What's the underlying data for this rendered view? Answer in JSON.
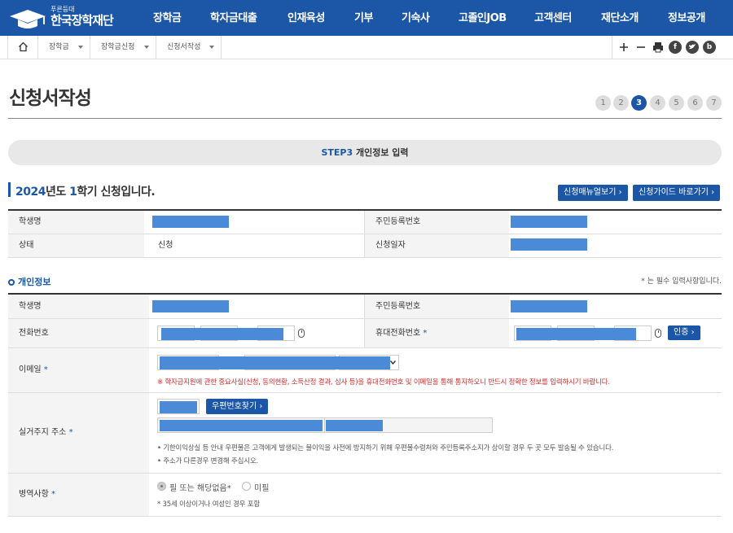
{
  "header": {
    "logo_sub": "푸른등대",
    "logo_name": "한국장학재단",
    "nav": [
      "장학금",
      "학자금대출",
      "인재육성",
      "기부",
      "기숙사",
      "고졸인JOB",
      "고객센터",
      "재단소개",
      "정보공개"
    ]
  },
  "breadcrumb": {
    "items": [
      "장학금",
      "장학금신청",
      "신청서작성"
    ],
    "tools": [
      "+",
      "−",
      "print-icon",
      "f",
      "twitter-icon",
      "b"
    ]
  },
  "page": {
    "title": "신청서작성",
    "steps": [
      "1",
      "2",
      "3",
      "4",
      "5",
      "6",
      "7"
    ],
    "active_step": "3",
    "banner_step": "STEP3",
    "banner_text": " 개인정보 입력"
  },
  "section": {
    "year": "2024",
    "mid1": "년도 ",
    "term": "1",
    "mid2": "학기 신청입니다.",
    "btn_manual": "신청매뉴얼보기 ›",
    "btn_guide": "신청가이드 바로가기 ›"
  },
  "summary": {
    "student_name_label": "학생명",
    "rrn_label": "주민등록번호",
    "status_label": "상태",
    "status_value": "신청",
    "apply_date_label": "신청일자"
  },
  "personal": {
    "title": "개인정보",
    "required_note": "* 는 필수 입력사항입니다.",
    "student_name_label": "학생명",
    "rrn_label": "주민등록번호",
    "phone_label": "전화번호",
    "mobile_label": "휴대전화번호",
    "auth_btn": "인증 ›",
    "email_label": "이메일",
    "email_warning": "※ 학자금지원에 관한 중요사실(신청, 동의현황, 소득산정 결과, 심사 등)을 휴대전화번호 및 이메일을 통해 통지하오니 반드시 정확한 정보를 입력하시기 바랍니다.",
    "address_label": "실거주지 주소",
    "postal_btn": "우편번호찾기 ›",
    "address_note1": "• 기한이익상실 등 안내 우편물은 고객에게 발생되는 불이익을 사전에 방지하기 위해 우편물수령처와 주민등록주소지가 상이할 경우 두 곳 모두 발송될 수 있습니다.",
    "address_note2": "• 주소가 다른경우 변경해 주십시오.",
    "military_label": "병역사항",
    "military_opt1": "필 또는 해당없음*",
    "military_opt2": "미필",
    "military_note": "* 35세 이상이거나 여성인 경우 포함",
    "required_mark": "*"
  },
  "colors": {
    "brand": "#1b57a6",
    "redacted": "#4a8ad6",
    "warning": "#d62b2b"
  }
}
